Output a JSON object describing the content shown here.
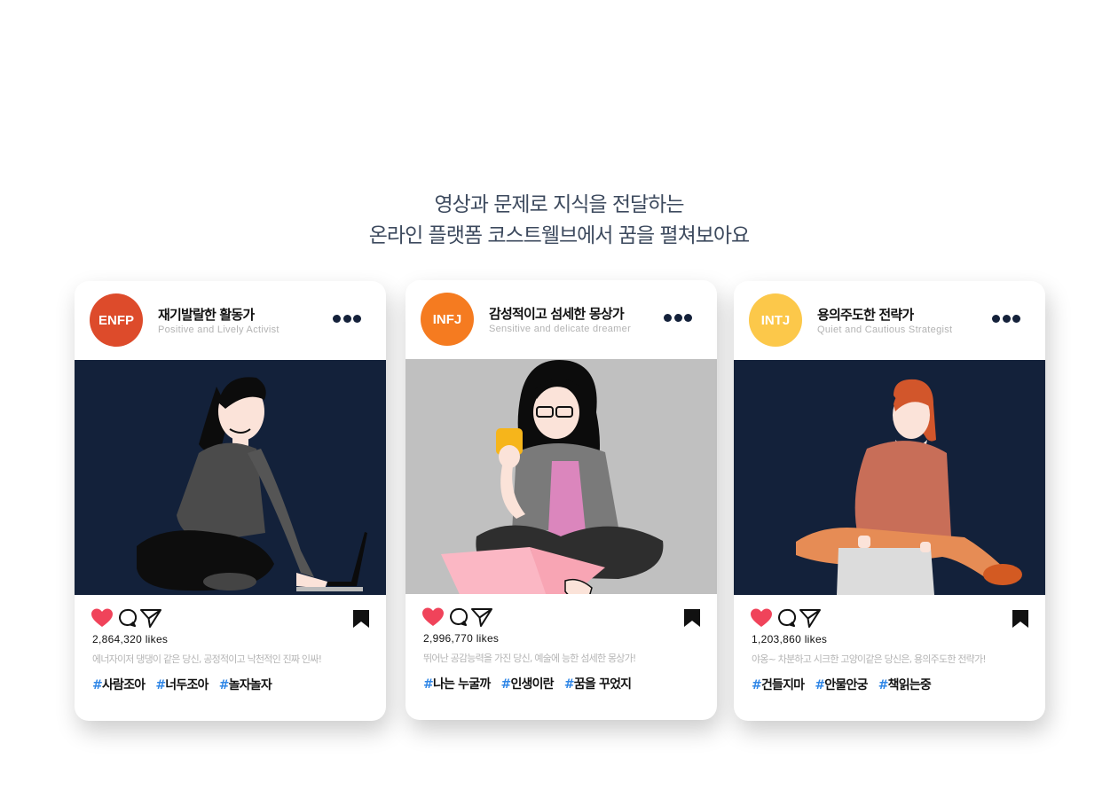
{
  "headline": {
    "line1": "영상과 문제로 지식을 전달하는",
    "line2": "온라인 플랫폼 코스트웰브에서 꿈을 펼쳐보아요"
  },
  "cards": [
    {
      "badge": "ENFP",
      "badge_color": "#dd4b2b",
      "title": "재기발랄한 활동가",
      "subtitle": "Positive and Lively Activist",
      "photo_bg": "#13213a",
      "likes": "2,864,320 likes",
      "description": "에너자이저 댕댕이 같은 당신, 공정적이고 낙천적인 진짜 인싸!",
      "tags": [
        "사람조아",
        "너두조아",
        "놀자놀자"
      ]
    },
    {
      "badge": "INFJ",
      "badge_color": "#f57b20",
      "title": "감성적이고 섬세한 몽상가",
      "subtitle": "Sensitive and delicate dreamer",
      "photo_bg": "#c0c0c0",
      "likes": "2,996,770 likes",
      "description": "뛰어난 공감능력을 가진 당신, 예술에 능한 섬세한 몽상가!",
      "tags": [
        "나는 누굴까",
        "인생이란",
        "꿈을 꾸었지"
      ]
    },
    {
      "badge": "INTJ",
      "badge_color": "#fcc84a",
      "title": "용의주도한 전략가",
      "subtitle": "Quiet and Cautious Strategist",
      "photo_bg": "#13213a",
      "likes": "1,203,860 likes",
      "description": "야옹~ 차분하고 시크한 고양이같은 당신은, 용의주도한 전략가!",
      "tags": [
        "건들지마",
        "안물안궁",
        "책읽는중"
      ]
    }
  ],
  "icons": {
    "like": "heart-icon",
    "comment": "comment-bubble-icon",
    "share": "paper-plane-icon",
    "save": "bookmark-icon",
    "more": "more-dots-icon",
    "like_color": "#f0435a",
    "hash_color": "#2f86e6"
  }
}
